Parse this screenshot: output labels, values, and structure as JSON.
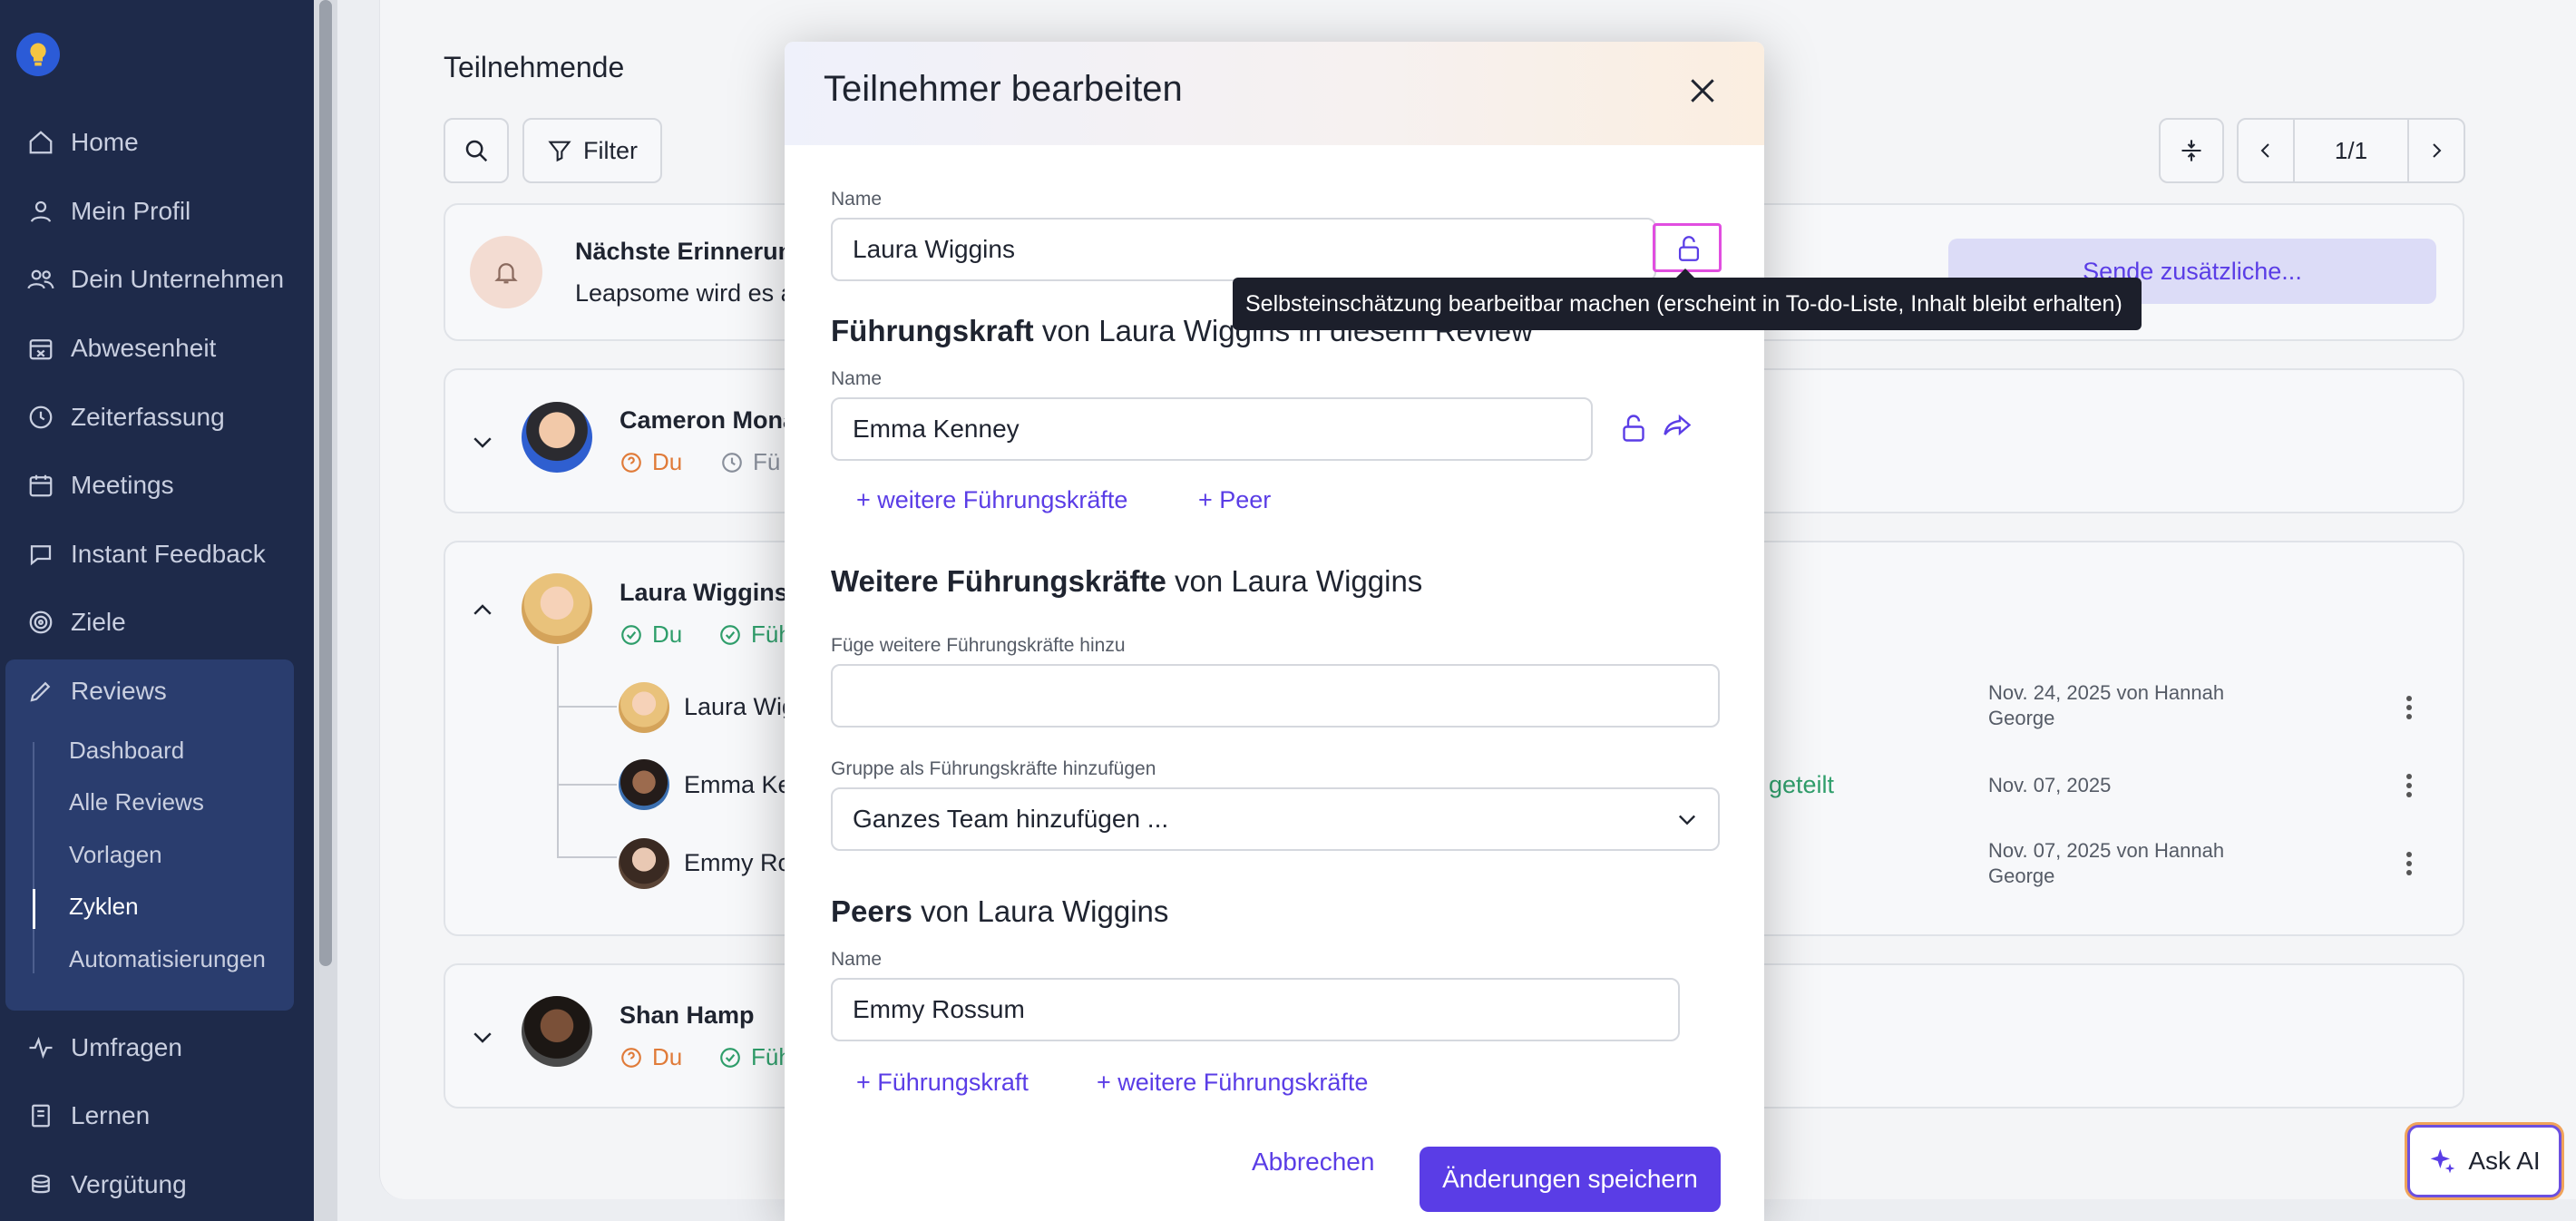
{
  "sidebar": {
    "items": [
      {
        "label": "Home",
        "icon": "home-icon"
      },
      {
        "label": "Mein Profil",
        "icon": "user-icon"
      },
      {
        "label": "Dein Unternehmen",
        "icon": "users-icon"
      },
      {
        "label": "Abwesenheit",
        "icon": "calendar-x-icon"
      },
      {
        "label": "Zeiterfassung",
        "icon": "clock-icon"
      },
      {
        "label": "Meetings",
        "icon": "calendar-icon"
      },
      {
        "label": "Instant Feedback",
        "icon": "chat-icon"
      },
      {
        "label": "Ziele",
        "icon": "target-icon"
      },
      {
        "label": "Reviews",
        "icon": "pencil-icon"
      },
      {
        "label": "Umfragen",
        "icon": "pulse-icon"
      },
      {
        "label": "Lernen",
        "icon": "book-icon"
      },
      {
        "label": "Vergütung",
        "icon": "coins-icon"
      }
    ],
    "reviews_sub": [
      "Dashboard",
      "Alle Reviews",
      "Vorlagen",
      "Zyklen",
      "Automatisierungen"
    ]
  },
  "main": {
    "section_title": "Teilnehmende",
    "filter_label": "Filter",
    "pagination": "1/1",
    "reminder": {
      "title": "Nächste Erinnerun",
      "text": "Leapsome wird es a",
      "send_button": "Sende zusätzliche..."
    },
    "participants": [
      {
        "name": "Cameron Mona",
        "s1": "Du",
        "s2": "Fü"
      },
      {
        "name": "Laura Wiggins",
        "s1": "Du",
        "s2": "Füh"
      },
      {
        "name": "Shan Hamp",
        "s1": "Du",
        "s2": "Füh"
      }
    ],
    "reviewers": [
      {
        "name": "Laura Wig",
        "date": "Nov. 24, 2025 von Hannah",
        "date2": "George"
      },
      {
        "name": "Emma Ke",
        "date": "Nov. 07, 2025",
        "date2": "",
        "extra": "geteilt"
      },
      {
        "name": "Emmy Ro",
        "date": "Nov. 07, 2025 von Hannah",
        "date2": "George"
      }
    ]
  },
  "modal": {
    "title": "Teilnehmer bearbeiten",
    "name_label": "Name",
    "name_value": "Laura Wiggins",
    "tooltip": "Selbsteinschätzung bearbeitbar machen (erscheint in To-do-Liste, Inhalt bleibt erhalten)",
    "manager_heading_bold": "Führungskraft",
    "manager_heading_rest": " von Laura Wiggins in diesem Review",
    "manager_label": "Name",
    "manager_value": "Emma Kenney",
    "link_more_managers": "+ weitere Führungskräfte",
    "link_peer": "+ Peer",
    "more_heading_bold": "Weitere Führungskräfte",
    "more_heading_rest": " von Laura Wiggins",
    "more_label": "Füge weitere Führungskräfte hinzu",
    "more_value": "",
    "group_label": "Gruppe als Führungskräfte hinzufügen",
    "group_value": "Ganzes Team hinzufügen ...",
    "peers_heading_bold": "Peers",
    "peers_heading_rest": " von Laura Wiggins",
    "peers_label": "Name",
    "peers_value": "Emmy Rossum",
    "link_manager": "+ Führungskraft",
    "link_more_managers2": "+ weitere Führungskräfte",
    "cancel": "Abbrechen",
    "save": "Änderungen speichern"
  },
  "ask_ai": "Ask AI",
  "colors": {
    "accent": "#5a3de6",
    "sidebar": "#1e2a4a",
    "success": "#2f9e6b",
    "warning": "#e07b39"
  }
}
